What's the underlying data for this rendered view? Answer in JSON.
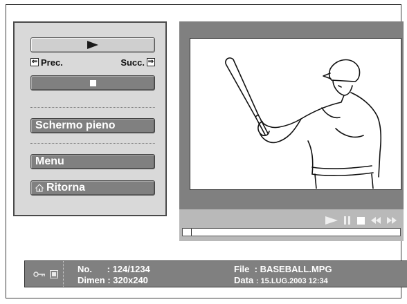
{
  "controls": {
    "play_icon": "play-icon",
    "prev_label": "Prec.",
    "next_label": "Succ.",
    "prev_arrow": "⇐",
    "next_arrow": "⇒",
    "stop_icon": "stop-icon",
    "fullscreen_label": "Schermo pieno",
    "menu_label": "Menu",
    "back_label": "Ritorna"
  },
  "viewer": {
    "image_subject": "baseball batter line drawing",
    "playback_icons": [
      "play-icon",
      "pause-icon",
      "stop-icon",
      "rewind-icon",
      "fast-forward-icon"
    ],
    "progress": 0.04
  },
  "info": {
    "no_label": "No.",
    "no_value": ": 124/1234",
    "dimen_label": "Dimen",
    "dimen_value": ": 320x240",
    "file_label": "File",
    "file_value": ": BASEBALL.MPG",
    "data_label": "Data",
    "data_value": ": 15.LUG.2003 12:34"
  },
  "colors": {
    "panel": "#d9d9d9",
    "dark_button": "#808080",
    "viewer_bg": "#808080",
    "control_strip": "#b9b9b9",
    "infobar": "#808080"
  }
}
